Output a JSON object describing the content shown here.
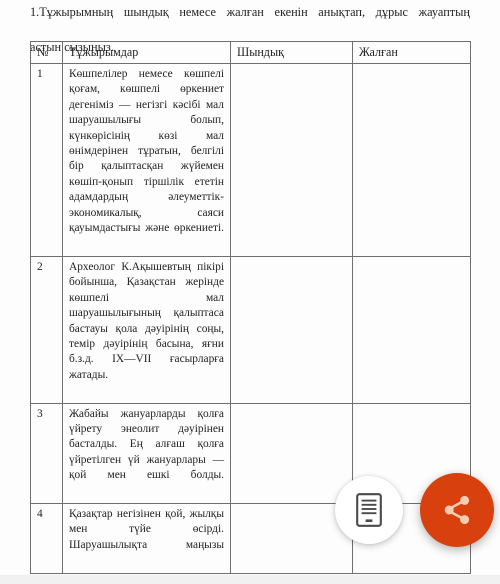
{
  "page": {
    "prompt_line1": "1.Тұжырымның шындық немесе жалған екенін анықтап, дұрыс жауаптың",
    "prompt_line2": "астын сызыңыз."
  },
  "table": {
    "headers": {
      "num": "№",
      "statement": "Тұжырымдар",
      "true": "Шындық",
      "false": "Жалған"
    },
    "rows": [
      {
        "num": "1",
        "statement": "Көшпелілер немесе көшпелі қоғам, көшпелі өркениет дегеніміз — негізгі кәсібі мал шаруашылығы болып, күнкөрісінің көзі мал өнімдерінен тұратын, белгілі бір қалыптасқан жүйемен көшіп-қонып тіршілік ететін адамдардың әлеуметтік-экономикалық, саяси қауымдастығы және өркениеті.",
        "true": "",
        "false": ""
      },
      {
        "num": "2",
        "statement": "Археолог К.Ақышевтың пікірі бойынша, Қазақстан жерінде көшпелі мал шаруашылығының қалыптаса бастауы қола дәуірінің соңы, темір дәуірінің басына, яғни б.з.д. IX—VII ғасырларға жатады.",
        "true": "",
        "false": ""
      },
      {
        "num": "3",
        "statement": "Жабайы жануарларды қолға үйрету энеолит дәуірінен басталды. Ең алғаш қолға үйретілген үй жануарлары — қой мен ешкі болды.",
        "true": "",
        "false": ""
      },
      {
        "num": "4",
        "statement": "Қазақтар негізінен қой, жылқы мен түйе өсірді. Шаруашылықта маңызы",
        "true": "",
        "false": ""
      }
    ]
  },
  "floating_buttons": {
    "reader": {
      "icon": "document-reader-icon",
      "color": "#ffffff"
    },
    "share": {
      "icon": "share-icon",
      "color": "#d8400d"
    }
  }
}
